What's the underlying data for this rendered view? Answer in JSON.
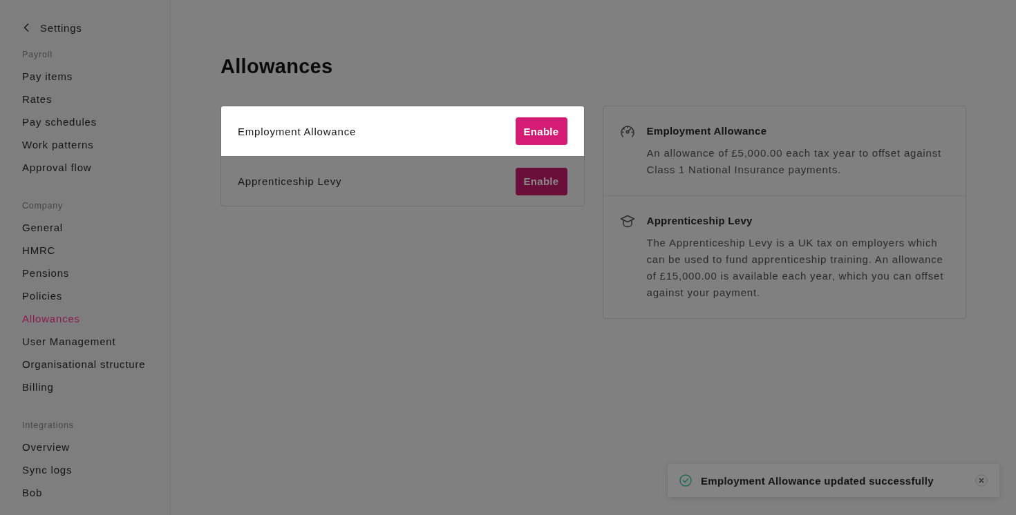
{
  "sidebar": {
    "back_link": {
      "label": "Settings"
    },
    "sections": [
      {
        "heading": "Payroll",
        "items": [
          {
            "label": "Pay items",
            "selected": false
          },
          {
            "label": "Rates",
            "selected": false
          },
          {
            "label": "Pay schedules",
            "selected": false
          },
          {
            "label": "Work patterns",
            "selected": false
          },
          {
            "label": "Approval flow",
            "selected": false
          }
        ]
      },
      {
        "heading": "Company",
        "items": [
          {
            "label": "General",
            "selected": false
          },
          {
            "label": "HMRC",
            "selected": false
          },
          {
            "label": "Pensions",
            "selected": false
          },
          {
            "label": "Policies",
            "selected": false
          },
          {
            "label": "Allowances",
            "selected": true
          },
          {
            "label": "User Management",
            "selected": false
          },
          {
            "label": "Organisational structure",
            "selected": false
          },
          {
            "label": "Billing",
            "selected": false
          }
        ]
      },
      {
        "heading": "Integrations",
        "items": [
          {
            "label": "Overview",
            "selected": false
          },
          {
            "label": "Sync logs",
            "selected": false
          },
          {
            "label": "Bob",
            "selected": false
          }
        ]
      }
    ]
  },
  "page": {
    "title": "Allowances"
  },
  "allowances": [
    {
      "name": "Employment Allowance",
      "button": "Enable",
      "highlighted": true
    },
    {
      "name": "Apprenticeship Levy",
      "button": "Enable",
      "highlighted": false
    }
  ],
  "info": [
    {
      "kind": "gauge",
      "title": "Employment Allowance",
      "description": "An allowance of £5,000.00 each tax year to offset against Class 1 National Insurance payments."
    },
    {
      "kind": "graduation",
      "title": "Apprenticeship Levy",
      "description": "The Apprenticeship Levy is a UK tax on employers which can be used to fund apprenticeship training. An allowance of £15,000.00 is available each year, which you can offset against your payment."
    }
  ],
  "toast": {
    "message": "Employment Allowance updated successfully"
  }
}
